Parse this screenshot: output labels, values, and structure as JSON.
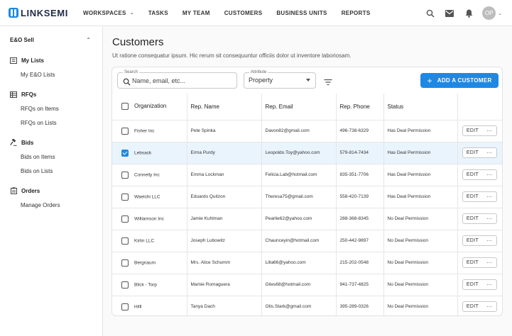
{
  "brand": {
    "name": "LINKSEMI",
    "accent": "#1e88e5"
  },
  "nav": [
    {
      "label": "WORKSPACES",
      "has_caret": true
    },
    {
      "label": "TASKS"
    },
    {
      "label": "MY TEAM"
    },
    {
      "label": "CUSTOMERS"
    },
    {
      "label": "BUSINESS UNITS"
    },
    {
      "label": "REPORTS"
    }
  ],
  "user": {
    "initials": "OP"
  },
  "sidebar": {
    "header": "E&O Sell",
    "sections": [
      {
        "label": "My Lists",
        "icon": "list-icon",
        "items": [
          "My E&O Lists"
        ]
      },
      {
        "label": "RFQs",
        "icon": "table-icon",
        "items": [
          "RFQs on Items",
          "RFQs on Lists"
        ]
      },
      {
        "label": "Bids",
        "icon": "gavel-icon",
        "items": [
          "Bids on Items",
          "Bids on Lists"
        ]
      },
      {
        "label": "Orders",
        "icon": "clipboard-icon",
        "items": [
          "Manage Orders"
        ]
      }
    ]
  },
  "page": {
    "title": "Customers",
    "description": "Ut ratione consequatur ipsum. Hic rerum sit consequuntur officiis dolor ut inventore laboriosam."
  },
  "toolbar": {
    "search_label": "Search",
    "search_placeholder": "Name, email, etc...",
    "attribute_label": "Attribute",
    "attribute_value": "Property",
    "add_label": "ADD A CUSTOMER"
  },
  "table": {
    "headers": [
      "Organization",
      "Rep. Name",
      "Rep. Email",
      "Rep. Phone",
      "Status"
    ],
    "edit_label": "EDIT",
    "more_label": "···",
    "rows": [
      {
        "org": "Fisher Inc",
        "name": "Pete Spinka",
        "email": "Davon82@gmail.com",
        "phone": "496-738-6329",
        "status": "Has Deal Permission",
        "selected": false
      },
      {
        "org": "Lebsack",
        "name": "Erma Purdy",
        "email": "Leopoldo.Toy@yahoo.com",
        "phone": "579-814-7434",
        "status": "Has Deal Permission",
        "selected": true
      },
      {
        "org": "Connelly Inc",
        "name": "Emma Lockman",
        "email": "Felicia.Lab@hotmail.com",
        "phone": "835-351-7706",
        "status": "Has Deal Permission",
        "selected": false
      },
      {
        "org": "Waelchi LLC",
        "name": "Eduardo Quitzon",
        "email": "Theresa75@gmail.com",
        "phone": "558-420-7139",
        "status": "Has Deal Permission",
        "selected": false
      },
      {
        "org": "Williamson Inc",
        "name": "Jamie Kuhlman",
        "email": "Pearlie62@yahoo.com",
        "phone": "288-368-8345",
        "status": "No Deal Permission",
        "selected": false
      },
      {
        "org": "Kirlin LLC",
        "name": "Joseph Lubowitz",
        "email": "Chaunceyin@hotmail.com",
        "phone": "250-442-9897",
        "status": "No Deal Permission",
        "selected": false
      },
      {
        "org": "Bergnaum",
        "name": "Mrs. Alice Schumm",
        "email": "Lilla66@yahoo.com",
        "phone": "215-202-0548",
        "status": "No Deal Permission",
        "selected": false
      },
      {
        "org": "Blick - Torp",
        "name": "Mamie Romaguera",
        "email": "Giles68@hotmail.com",
        "phone": "941-737-4825",
        "status": "No Deal Permission",
        "selected": false
      },
      {
        "org": "Hilll",
        "name": "Tanya Dach",
        "email": "Otis.Stark@gmail.com",
        "phone": "395-289-0326",
        "status": "No Deal Permission",
        "selected": false
      }
    ]
  }
}
